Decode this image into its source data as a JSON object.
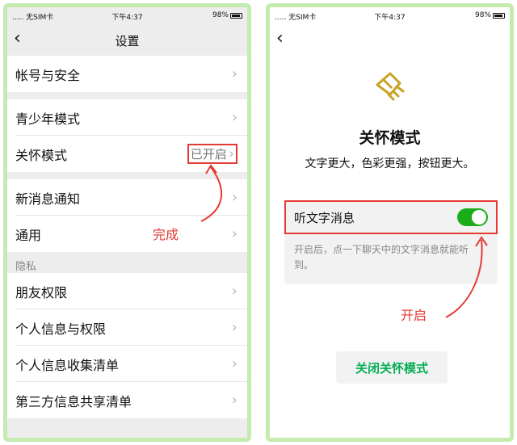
{
  "left": {
    "status": {
      "carrier": "..... 无SIM卡",
      "time": "下午4:37",
      "battery": "98%"
    },
    "nav": {
      "title": "设置",
      "back_icon": "chevron-left-icon"
    },
    "rows": {
      "account": "帐号与安全",
      "youth": "青少年模式",
      "care": "关怀模式",
      "care_value": "已开启",
      "notify": "新消息通知",
      "general": "通用",
      "privacy_header": "隐私",
      "friends": "朋友权限",
      "personal": "个人信息与权限",
      "collect": "个人信息收集清单",
      "third": "第三方信息共享清单"
    },
    "annotation": "完成"
  },
  "right": {
    "status": {
      "carrier": "..... 无SIM卡",
      "time": "下午4:37",
      "battery": "98%"
    },
    "nav": {
      "back_icon": "chevron-left-icon"
    },
    "icon": "care-hand-icon",
    "title": "关怀模式",
    "subtitle": "文字更大，色彩更强，按钮更大。",
    "toggle": {
      "label": "听文字消息",
      "on": true
    },
    "description": "开启后，点一下聊天中的文字消息就能听到。",
    "close_button": "关闭关怀模式",
    "annotation": "开启"
  },
  "colors": {
    "accent": "#1aad19",
    "annotation": "#e53935",
    "frame": "#c4ecb0",
    "button_text": "#06ae56"
  }
}
